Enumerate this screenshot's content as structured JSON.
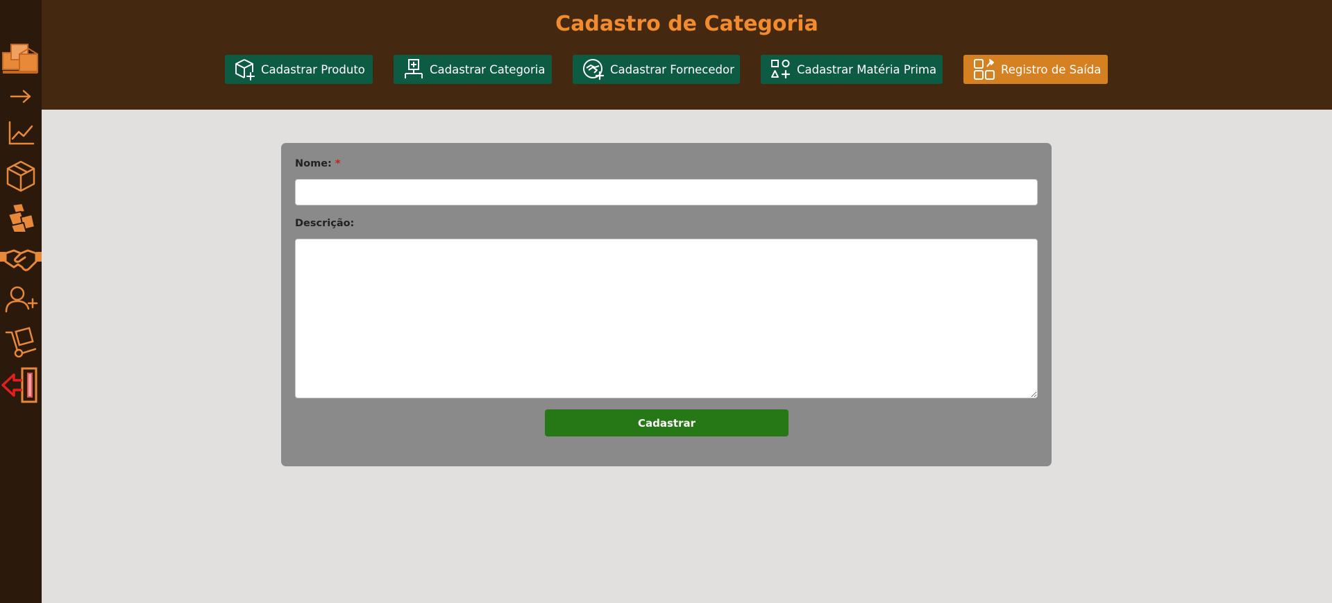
{
  "header": {
    "title": "Cadastro de Categoria",
    "nav": [
      {
        "label": "Cadastrar Produto",
        "icon": "box-plus-icon"
      },
      {
        "label": "Cadastrar Categoria",
        "icon": "hierarchy-plus-icon"
      },
      {
        "label": "Cadastrar Fornecedor",
        "icon": "handshake-plus-icon"
      },
      {
        "label": "Cadastrar Matéria Prima",
        "icon": "shapes-plus-icon"
      },
      {
        "label": "Registro de Saída",
        "icon": "grid-pin-icon",
        "active": true
      }
    ]
  },
  "sidebar": {
    "items": [
      {
        "name": "boxes-icon"
      },
      {
        "name": "arrow-right-icon"
      },
      {
        "name": "chart-line-icon"
      },
      {
        "name": "package-icon"
      },
      {
        "name": "boxes-stack-icon"
      },
      {
        "name": "handshake-icon"
      },
      {
        "name": "user-plus-icon"
      },
      {
        "name": "hand-truck-icon"
      },
      {
        "name": "logout-icon"
      }
    ]
  },
  "form": {
    "name_label": "Nome:",
    "required_mark": "*",
    "name_value": "",
    "description_label": "Descrição:",
    "description_value": "",
    "submit_label": "Cadastrar"
  },
  "colors": {
    "sidebar_bg": "#2b190c",
    "header_bg": "#452810",
    "accent": "#f28a2e",
    "nav_bg": "#0e5b44",
    "nav_active_bg": "#d68121",
    "panel_bg": "#898a89",
    "submit_bg": "#267716",
    "page_bg": "#e2dfdf"
  }
}
